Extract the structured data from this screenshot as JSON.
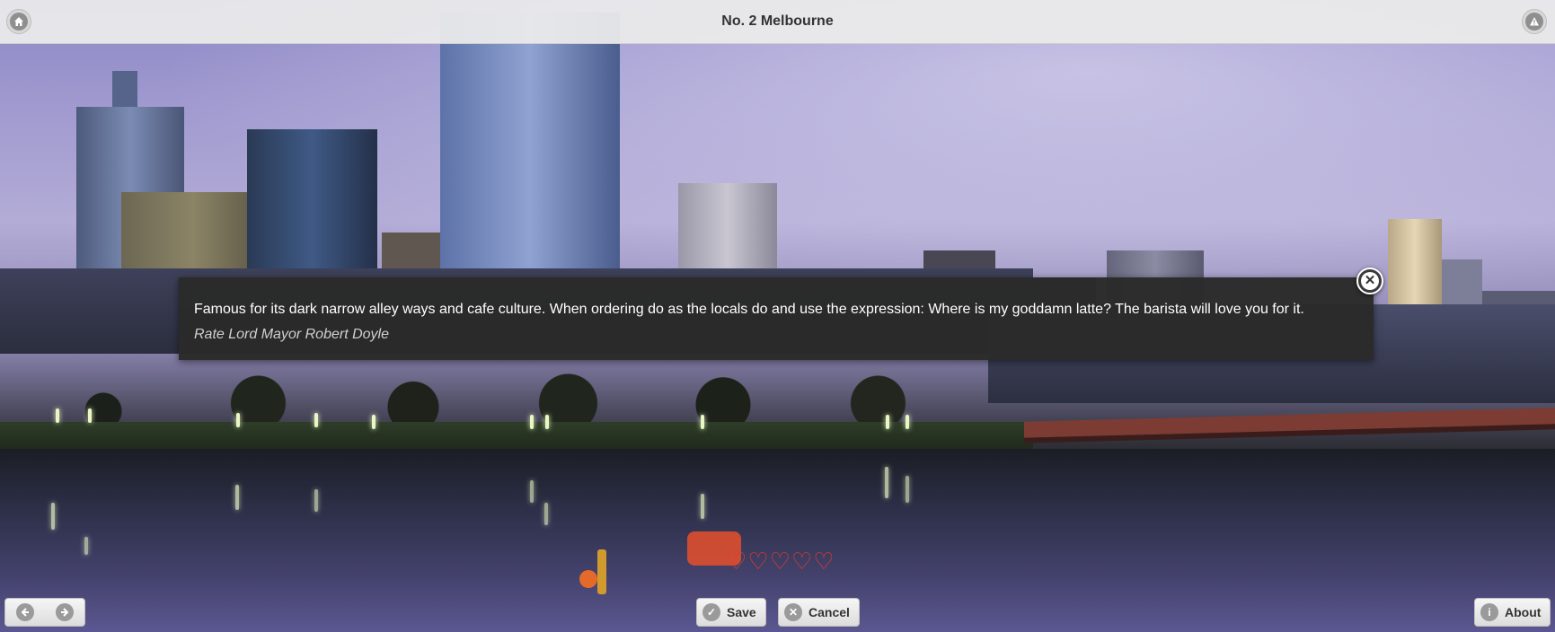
{
  "header": {
    "title": "No. 2 Melbourne",
    "home_icon": "home-icon",
    "alert_icon": "alert-icon"
  },
  "popup": {
    "description": "Famous for its dark narrow alley ways and cafe culture. When ordering do as the locals do and use the expression: Where is my goddamn latte? The barista will love you for it.",
    "subtitle": "Rate Lord Mayor Robert Doyle",
    "close_icon": "close-icon"
  },
  "rating": {
    "value": 0,
    "max": 5,
    "heart_glyph": "♡",
    "color": "#e53b2a"
  },
  "footer": {
    "prev_icon": "arrow-left-icon",
    "next_icon": "arrow-right-icon",
    "save_label": "Save",
    "cancel_label": "Cancel",
    "about_label": "About"
  }
}
